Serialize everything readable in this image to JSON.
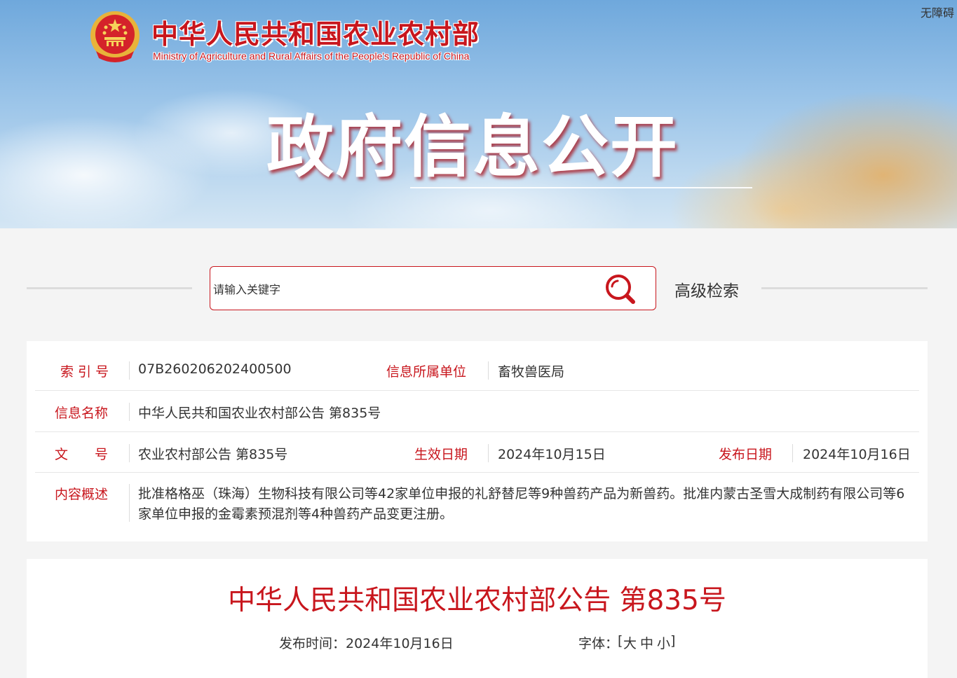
{
  "header": {
    "ministry_cn": "中华人民共和国农业农村部",
    "ministry_en": "Ministry of Agriculture and Rural Affairs of the People's Republic of China",
    "banner_title": "政府信息公开",
    "accessibility": "无障碍"
  },
  "search": {
    "placeholder": "请输入关键字",
    "advanced_label": "高级检索",
    "icon": "search-icon"
  },
  "info": {
    "index_label": "索 引 号",
    "index_value": "07B260206202400500",
    "unit_label": "信息所属单位",
    "unit_value": "畜牧兽医局",
    "name_label": "信息名称",
    "name_value": "中华人民共和国农业农村部公告 第835号",
    "docno_label": "文　　号",
    "docno_value": "农业农村部公告 第835号",
    "effective_label": "生效日期",
    "effective_value": "2024年10月15日",
    "publish_label": "发布日期",
    "publish_value": "2024年10月16日",
    "summary_label": "内容概述",
    "summary_value": "批准格格巫（珠海）生物科技有限公司等42家单位申报的礼舒替尼等9种兽药产品为新兽药。批准内蒙古圣雪大成制药有限公司等6家单位申报的金霉素预混剂等4种兽药产品变更注册。"
  },
  "article": {
    "title": "中华人民共和国农业农村部公告 第835号",
    "pubtime_label": "发布时间：",
    "pubtime_value": "2024年10月16日",
    "font_label": "字体：",
    "font_open": "[",
    "font_large": "大",
    "font_medium": "中",
    "font_small": "小",
    "font_close": "]"
  },
  "colors": {
    "accent": "#c8161d",
    "text": "#333333",
    "background": "#f4f4f4"
  }
}
